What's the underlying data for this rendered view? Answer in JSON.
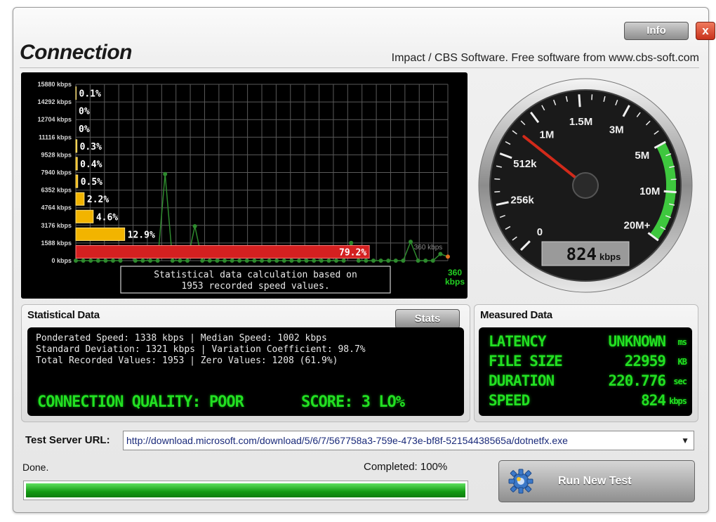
{
  "window": {
    "title": "Connection",
    "credit": "Impact / CBS Software. Free software from www.cbs-soft.com",
    "info_label": "Info",
    "close_glyph": "x"
  },
  "graph": {
    "y_ticks": [
      "15880 kbps",
      "14292 kbps",
      "12704 kbps",
      "11116 kbps",
      "9528 kbps",
      "7940 kbps",
      "6352 kbps",
      "4764 kbps",
      "3176 kbps",
      "1588 kbps",
      "0 kbps"
    ],
    "distribution": [
      {
        "pct": "0.1%",
        "fraction": 0.001
      },
      {
        "pct": "0%",
        "fraction": 0
      },
      {
        "pct": "0%",
        "fraction": 0
      },
      {
        "pct": "0.3%",
        "fraction": 0.003
      },
      {
        "pct": "0.4%",
        "fraction": 0.004
      },
      {
        "pct": "0.5%",
        "fraction": 0.005
      },
      {
        "pct": "2.2%",
        "fraction": 0.022
      },
      {
        "pct": "4.6%",
        "fraction": 0.046
      },
      {
        "pct": "12.9%",
        "fraction": 0.129
      },
      {
        "pct": "79.2%",
        "fraction": 0.792
      }
    ],
    "series_kbps": [
      0,
      0,
      0,
      0,
      0,
      0,
      0,
      1200,
      0,
      0,
      0,
      0,
      7800,
      0,
      0,
      0,
      3100,
      0,
      0,
      0,
      0,
      0,
      0,
      0,
      0,
      0,
      0,
      0,
      0,
      0,
      0,
      0,
      0,
      0,
      0,
      0,
      0,
      1600,
      0,
      0,
      0,
      0,
      0,
      0,
      0,
      1700,
      0,
      0,
      0,
      600,
      360
    ],
    "ymax_kbps": 15880,
    "mid_label": "360 kbps",
    "current_value": "360",
    "current_unit": "kbps",
    "note_line1": "Statistical data calculation based on",
    "note_line2": "1953 recorded speed values."
  },
  "gauge": {
    "labels": [
      "0",
      "256k",
      "512k",
      "1M",
      "1.5M",
      "3M",
      "5M",
      "10M",
      "20M+"
    ],
    "needle_value": "512k-1M",
    "readout_value": "824",
    "readout_unit": "kbps"
  },
  "statistical": {
    "title": "Statistical Data",
    "stats_button": "Stats",
    "line1": "Ponderated Speed: 1338 kbps | Median Speed: 1002 kbps",
    "line2": "Standard Deviation: 1321 kbps | Variation Coefficient: 98.7%",
    "line3": "Total Recorded Values: 1953 | Zero Values: 1208 (61.9%)",
    "quality": "CONNECTION QUALITY: POOR",
    "score": "SCORE: 3 LO%"
  },
  "measured": {
    "title": "Measured Data",
    "rows": [
      {
        "label": "LATENCY",
        "value": "UNKNOWN",
        "unit": "ms"
      },
      {
        "label": "FILE SIZE",
        "value": "22959",
        "unit": "KB"
      },
      {
        "label": "DURATION",
        "value": "220.776",
        "unit": "sec"
      },
      {
        "label": "SPEED",
        "value": "824",
        "unit": "kbps"
      }
    ]
  },
  "server": {
    "label": "Test Server URL:",
    "url": "http://download.microsoft.com/download/5/6/7/567758a3-759e-473e-bf8f-52154438565a/dotnetfx.exe"
  },
  "footer": {
    "status": "Done.",
    "completed_text": "Completed: 100%",
    "progress_fraction": 1.0,
    "run_button": "Run New Test"
  },
  "colors": {
    "lcd_green": "#22e022",
    "red_bar": "#d42020",
    "orange_bar": "#f2b400",
    "gauge_green": "#3ec73e",
    "needle": "#d22a1a"
  }
}
